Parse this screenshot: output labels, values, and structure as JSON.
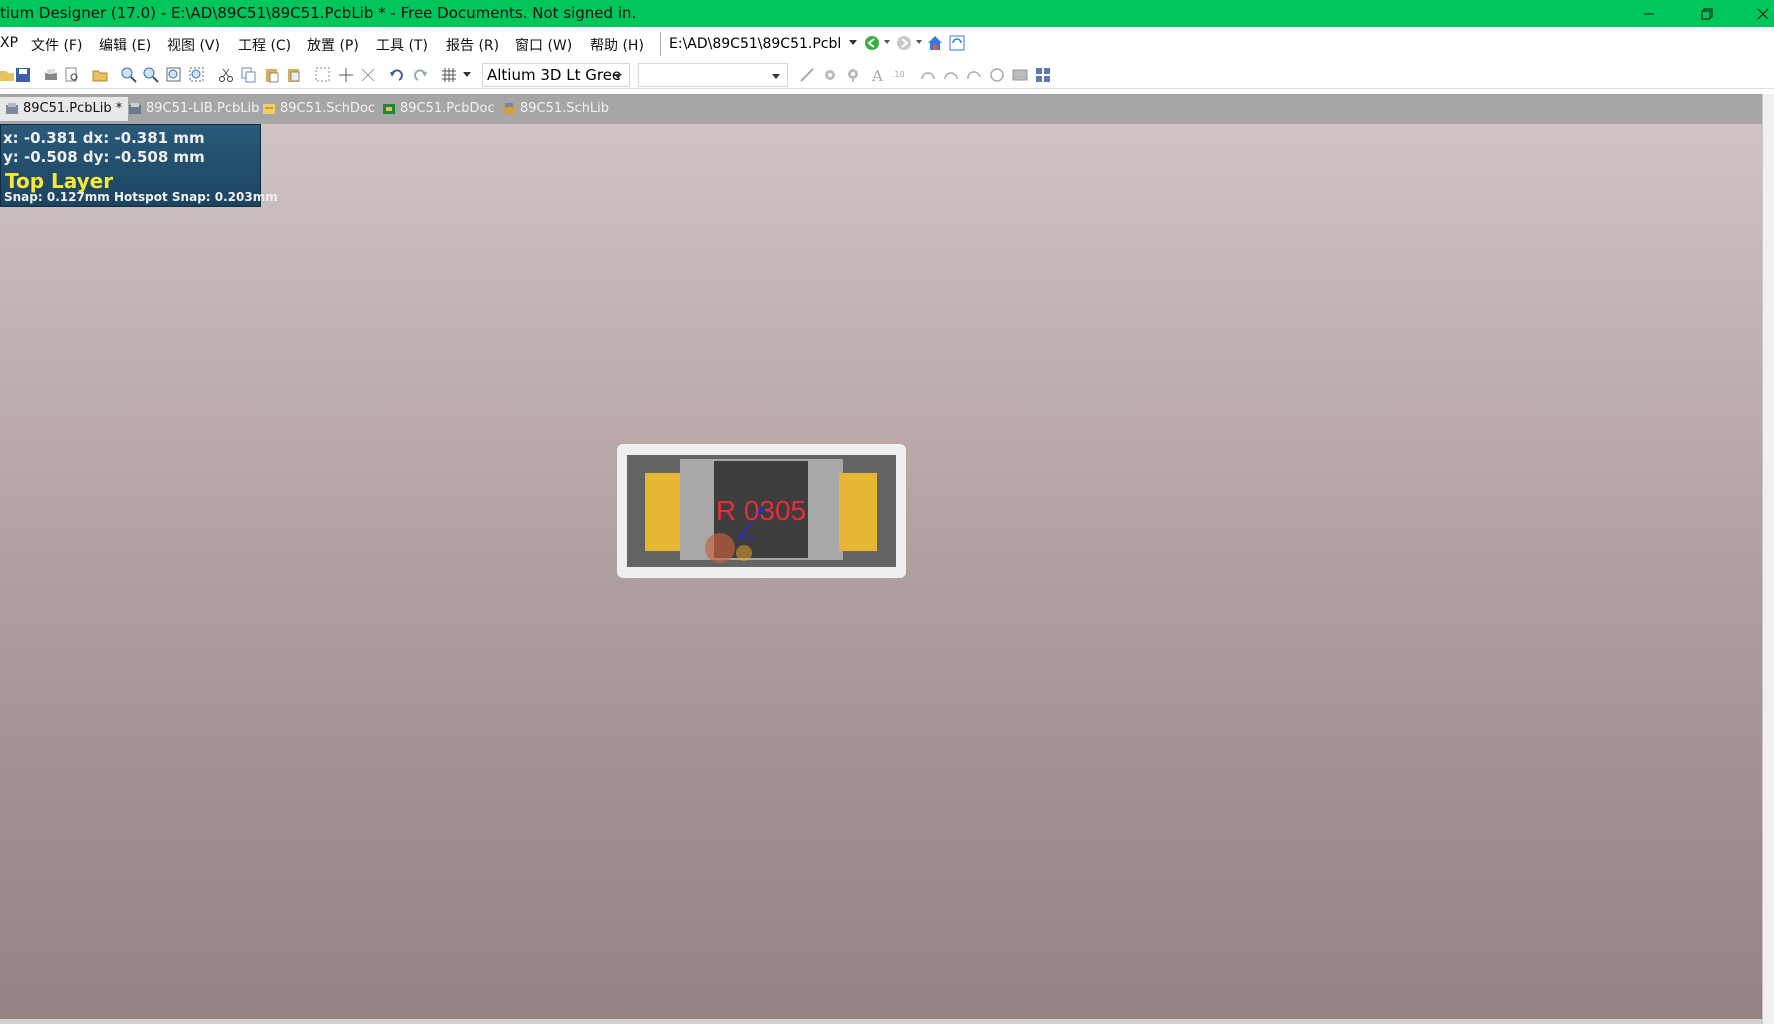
{
  "window": {
    "title": "tium Designer (17.0) - E:\\AD\\89C51\\89C51.PcbLib * - Free Documents. Not signed in."
  },
  "menubar": {
    "items": [
      {
        "label": "XP"
      },
      {
        "label": "文件 (F)"
      },
      {
        "label": "编辑 (E)"
      },
      {
        "label": "视图 (V)"
      },
      {
        "label": "工程 (C)"
      },
      {
        "label": "放置 (P)"
      },
      {
        "label": "工具 (T)"
      },
      {
        "label": "报告 (R)"
      },
      {
        "label": "窗口 (W)"
      },
      {
        "label": "帮助 (H)"
      }
    ],
    "path": "E:\\AD\\89C51\\89C51.Pcbl"
  },
  "toolbar": {
    "view_config": "Altium 3D Lt Gree",
    "second_combo": ""
  },
  "tabs": [
    {
      "label": "89C51.PcbLib *",
      "active": true,
      "icon": "pcblib-icon"
    },
    {
      "label": "89C51-LIB.PcbLib",
      "active": false,
      "icon": "pcblib-icon"
    },
    {
      "label": "89C51.SchDoc",
      "active": false,
      "icon": "schdoc-icon"
    },
    {
      "label": "89C51.PcbDoc",
      "active": false,
      "icon": "pcbdoc-icon"
    },
    {
      "label": "89C51.SchLib",
      "active": false,
      "icon": "schlib-icon"
    }
  ],
  "hud": {
    "line1": "x: -0.381   dx: -0.381 mm",
    "line2": "y: -0.508   dy: -0.508 mm",
    "layer": "Top Layer",
    "snap": "Snap: 0.127mm Hotspot Snap: 0.203mm"
  },
  "component": {
    "designator": "R 0305",
    "pad_color": "#e6b732",
    "body_color": "#3d3d3d",
    "label_color": "#e0303a"
  }
}
